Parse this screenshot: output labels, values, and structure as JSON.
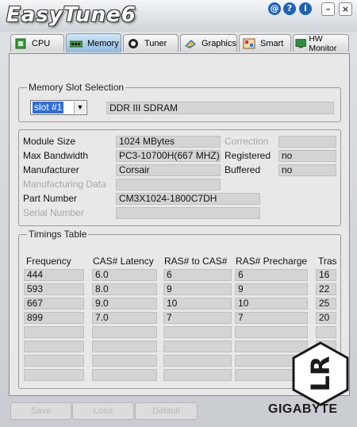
{
  "app": {
    "title": "EasyTune6"
  },
  "window_controls": [
    {
      "name": "at-icon",
      "glyph": "@"
    },
    {
      "name": "help-icon",
      "glyph": "?"
    },
    {
      "name": "info-icon",
      "glyph": "i"
    },
    {
      "name": "minimize-icon",
      "glyph": "–"
    },
    {
      "name": "close-icon",
      "glyph": "×"
    }
  ],
  "tabs": [
    {
      "label": "CPU",
      "icon": "cpu-icon"
    },
    {
      "label": "Memory",
      "icon": "memory-icon",
      "active": true
    },
    {
      "label": "Tuner",
      "icon": "tuner-icon"
    },
    {
      "label": "Graphics",
      "icon": "graphics-icon"
    },
    {
      "label": "Smart",
      "icon": "smart-icon"
    },
    {
      "label": "HW Monitor",
      "icon": "hw-monitor-icon"
    }
  ],
  "slot_selection": {
    "legend": "Memory Slot Selection",
    "selected": "slot #1",
    "memory_type": "DDR III SDRAM"
  },
  "module": {
    "module_size_label": "Module Size",
    "module_size": "1024 MBytes",
    "max_bandwidth_label": "Max Bandwidth",
    "max_bandwidth": "PC3-10700H(667 MHZ)",
    "manufacturer_label": "Manufacturer",
    "manufacturer": "Corsair",
    "manufacturing_data_label": "Manufacturing Data",
    "manufacturing_data": "",
    "part_number_label": "Part Number",
    "part_number": "CM3X1024-1800C7DH",
    "serial_number_label": "Serial Number",
    "serial_number": "",
    "correction_label": "Correction",
    "correction": "",
    "registered_label": "Registered",
    "registered": "no",
    "buffered_label": "Buffered",
    "buffered": "no"
  },
  "timings": {
    "legend": "Timings Table",
    "headers": [
      "Frequency",
      "CAS# Latency",
      "RAS# to CAS#",
      "RAS# Precharge",
      "Tras"
    ],
    "rows": [
      [
        "444",
        "6.0",
        "6",
        "6",
        "16"
      ],
      [
        "593",
        "8.0",
        "9",
        "9",
        "22"
      ],
      [
        "667",
        "9.0",
        "10",
        "10",
        "25"
      ],
      [
        "899",
        "7.0",
        "7",
        "7",
        "20"
      ],
      [
        "",
        "",
        "",
        "",
        ""
      ],
      [
        "",
        "",
        "",
        "",
        ""
      ],
      [
        "",
        "",
        "",
        "",
        ""
      ],
      [
        "",
        "",
        "",
        "",
        ""
      ]
    ]
  },
  "buttons": {
    "save": "Save",
    "load": "Load",
    "default": "Default"
  },
  "brand": "GIGABYTE",
  "watermark": "LR"
}
